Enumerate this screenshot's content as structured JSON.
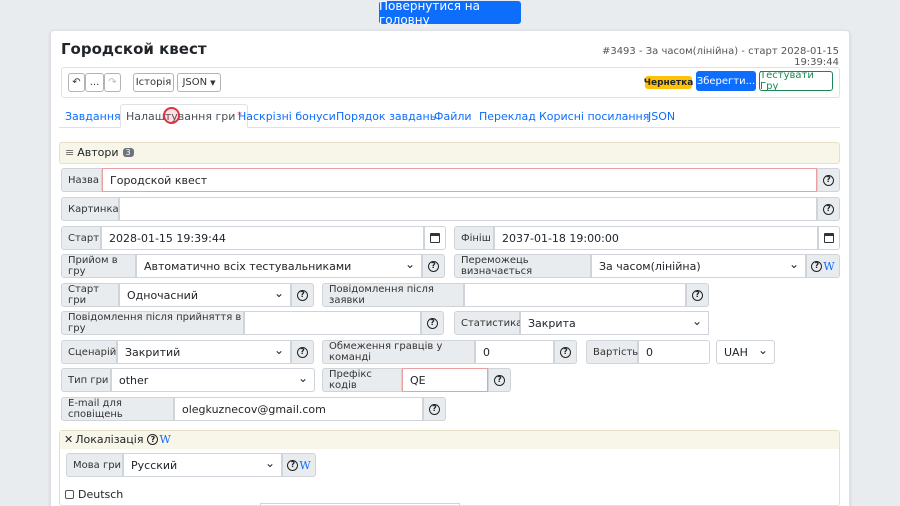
{
  "top_button": "Повернутися на головну",
  "title": "Городской квест",
  "subtitle": "#3493 - За часом(лінійна) - старт 2028-01-15 19:39:44",
  "toolbar": {
    "undo": "↶",
    "more": "...",
    "redo": "↷",
    "history": "Історія",
    "json": "JSON",
    "draft": "Чернетка",
    "save": "Зберегти...",
    "test": "Тестувати Гру"
  },
  "tabs": [
    "Завдання",
    "Налаштування гри",
    "Наскрізні бонуси",
    "Порядок завдань",
    "Файли",
    "Переклад",
    "Корисні посилання",
    "JSON"
  ],
  "tab_star": "*",
  "authors": {
    "label": "Автори",
    "count": "3"
  },
  "form": {
    "name_label": "Назва",
    "name_value": "Городской квест",
    "image_label": "Картинка",
    "image_value": "",
    "start_label": "Старт",
    "start_value": "2028-01-15 19:39:44",
    "finish_label": "Фініш",
    "finish_value": "2037-01-18 19:00:00",
    "join_label": "Прийом в гру",
    "join_value": "Автоматично всіх тестувальниками",
    "winner_label": "Переможець визначається",
    "winner_value": "За часом(лінійна)",
    "gamestart_label": "Старт гри",
    "gamestart_value": "Одночасний",
    "after_request_label": "Повідомлення після заявки",
    "after_request_value": "",
    "after_accept_label": "Повідомлення після прийняття в гру",
    "after_accept_value": "",
    "stats_label": "Статистика",
    "stats_value": "Закрита",
    "scenario_label": "Сценарій",
    "scenario_value": "Закритий",
    "team_limit_label": "Обмеження гравців у команді",
    "team_limit_value": "0",
    "price_label": "Вартість",
    "price_value": "0",
    "currency": "UAH",
    "type_label": "Тип гри",
    "type_value": "other",
    "prefix_label": "Префікс кодів",
    "prefix_value": "QE",
    "email_label": "E-mail для сповіщень",
    "email_value": "olegkuznecov@gmail.com"
  },
  "localization": {
    "title": "Локалізація",
    "lang_label": "Мова гри",
    "lang_value": "Русский",
    "checkbox_label": "Deutsch"
  },
  "icons": {
    "help": "?",
    "wiki": "W"
  }
}
